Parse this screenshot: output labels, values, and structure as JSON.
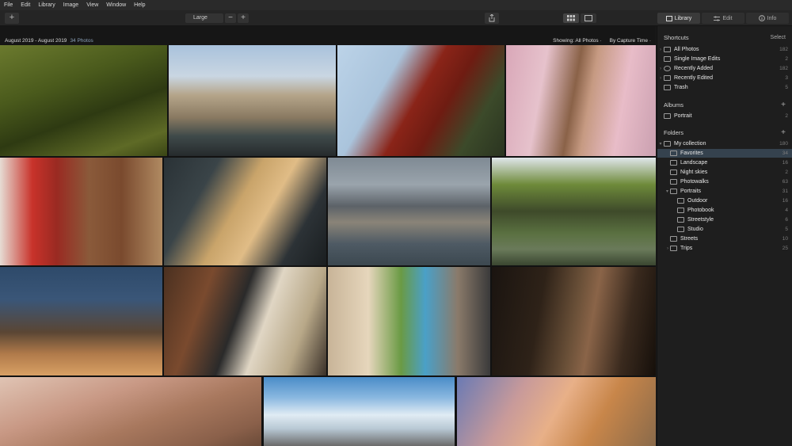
{
  "menu": [
    "File",
    "Edit",
    "Library",
    "Image",
    "View",
    "Window",
    "Help"
  ],
  "toolbar": {
    "size_label": "Large",
    "minus": "−",
    "plus": "+",
    "add": "+"
  },
  "tabs": [
    {
      "label": "Library",
      "icon": "library-icon",
      "active": true
    },
    {
      "label": "Edit",
      "icon": "sliders-icon",
      "active": false
    },
    {
      "label": "Info",
      "icon": "info-icon",
      "active": false
    }
  ],
  "info": {
    "dates": "August 2019 - August 2019",
    "count": "34 Photos",
    "showing": "Showing:  All Photos ·",
    "sort": "By Capture Time ·"
  },
  "sidebar": {
    "shortcuts_title": "Shortcuts",
    "shortcuts_action": "Select",
    "shortcuts": [
      {
        "label": "All Photos",
        "count": "182",
        "icon": "photos-icon"
      },
      {
        "label": "Single Image Edits",
        "count": "2",
        "icon": "grid-icon"
      },
      {
        "label": "Recently Added",
        "count": "182",
        "icon": "plus-circle-icon"
      },
      {
        "label": "Recently Edited",
        "count": "3",
        "icon": "sliders-icon"
      },
      {
        "label": "Trash",
        "count": "5",
        "icon": "trash-icon"
      }
    ],
    "albums_title": "Albums",
    "albums_action": "+",
    "albums": [
      {
        "label": "Portrait",
        "count": "2",
        "icon": "album-icon"
      }
    ],
    "folders_title": "Folders",
    "folders_action": "+",
    "folders": [
      {
        "label": "My collection",
        "count": "180",
        "indent": 0,
        "caret": "▾"
      },
      {
        "label": "Favorites",
        "count": "34",
        "indent": 1,
        "caret": "",
        "selected": true
      },
      {
        "label": "Landscape",
        "count": "16",
        "indent": 1,
        "caret": ""
      },
      {
        "label": "Night skies",
        "count": "2",
        "indent": 1,
        "caret": ""
      },
      {
        "label": "Photowalks",
        "count": "63",
        "indent": 1,
        "caret": ""
      },
      {
        "label": "Portraits",
        "count": "31",
        "indent": 1,
        "caret": "▾"
      },
      {
        "label": "Outdoor",
        "count": "16",
        "indent": 2,
        "caret": ""
      },
      {
        "label": "Photobook",
        "count": "4",
        "indent": 2,
        "caret": ""
      },
      {
        "label": "Streetstyle",
        "count": "6",
        "indent": 2,
        "caret": ""
      },
      {
        "label": "Studio",
        "count": "5",
        "indent": 2,
        "caret": ""
      },
      {
        "label": "Streets",
        "count": "10",
        "indent": 1,
        "caret": ""
      },
      {
        "label": "Trips",
        "count": "25",
        "indent": 1,
        "caret": "›"
      }
    ]
  },
  "colors": {
    "selection": "#35424e",
    "accent_text": "#8aa0b8"
  }
}
